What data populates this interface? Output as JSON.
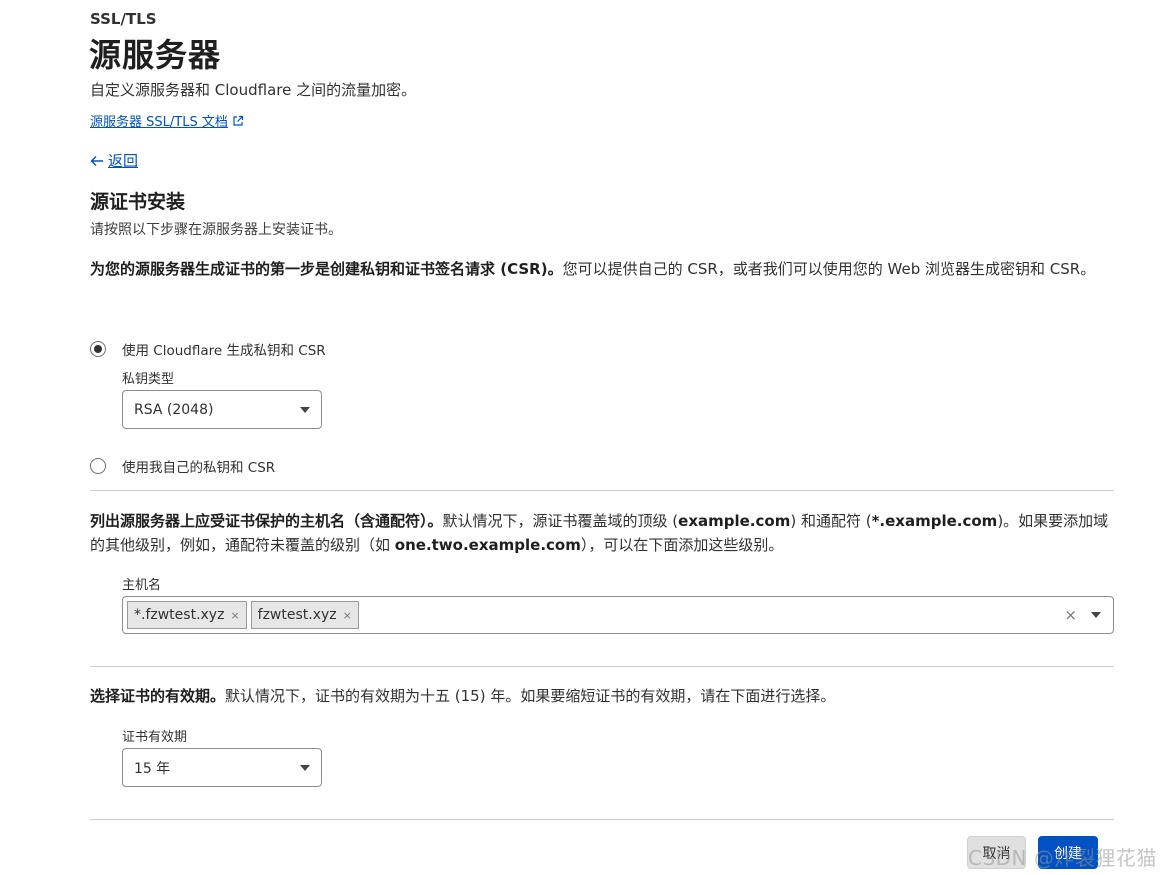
{
  "header": {
    "breadcrumb": "SSL/TLS",
    "title": "源服务器",
    "subtitle": "自定义源服务器和 Cloudflare 之间的流量加密。",
    "doc_link": "源服务器 SSL/TLS 文档",
    "doc_link_icon": "external-link-icon"
  },
  "back": {
    "label": "返回",
    "icon": "arrow-left-icon"
  },
  "section": {
    "title": "源证书安装",
    "intro": "请按照以下步骤在源服务器上安装证书。"
  },
  "step1": {
    "bold": "为您的源服务器生成证书的第一步是创建私钥和证书签名请求 (CSR)。",
    "text": "您可以提供自己的 CSR，或者我们可以使用您的 Web 浏览器生成密钥和 CSR。",
    "options": [
      {
        "label": "使用 Cloudflare 生成私钥和 CSR",
        "selected": true
      },
      {
        "label": "使用我自己的私钥和 CSR",
        "selected": false
      }
    ],
    "key_type_label": "私钥类型",
    "key_type_value": "RSA (2048)"
  },
  "step2": {
    "bold": "列出源服务器上应受证书保护的主机名（含通配符）。",
    "text_a": "默认情况下，源证书覆盖域的顶级 (",
    "bold_a": "example.com",
    "text_b": ") 和通配符 (",
    "bold_b": "*.example.com",
    "text_c": ")。如果要添加域的其他级别，例如，通配符未覆盖的级别（如 ",
    "bold_c": "one.two.example.com",
    "text_d": "），可以在下面添加这些级别。",
    "hostnames_label": "主机名",
    "hostnames": [
      "*.fzwtest.xyz",
      "fzwtest.xyz"
    ],
    "chip_remove": "×",
    "clear_all": "×"
  },
  "step3": {
    "bold": "选择证书的有效期。",
    "text": "默认情况下，证书的有效期为十五 (15) 年。如果要缩短证书的有效期，请在下面进行选择。",
    "validity_label": "证书有效期",
    "validity_value": "15 年"
  },
  "footer": {
    "cancel": "取消",
    "create": "创建",
    "watermark": "CSDN @炸裂狸花猫"
  }
}
